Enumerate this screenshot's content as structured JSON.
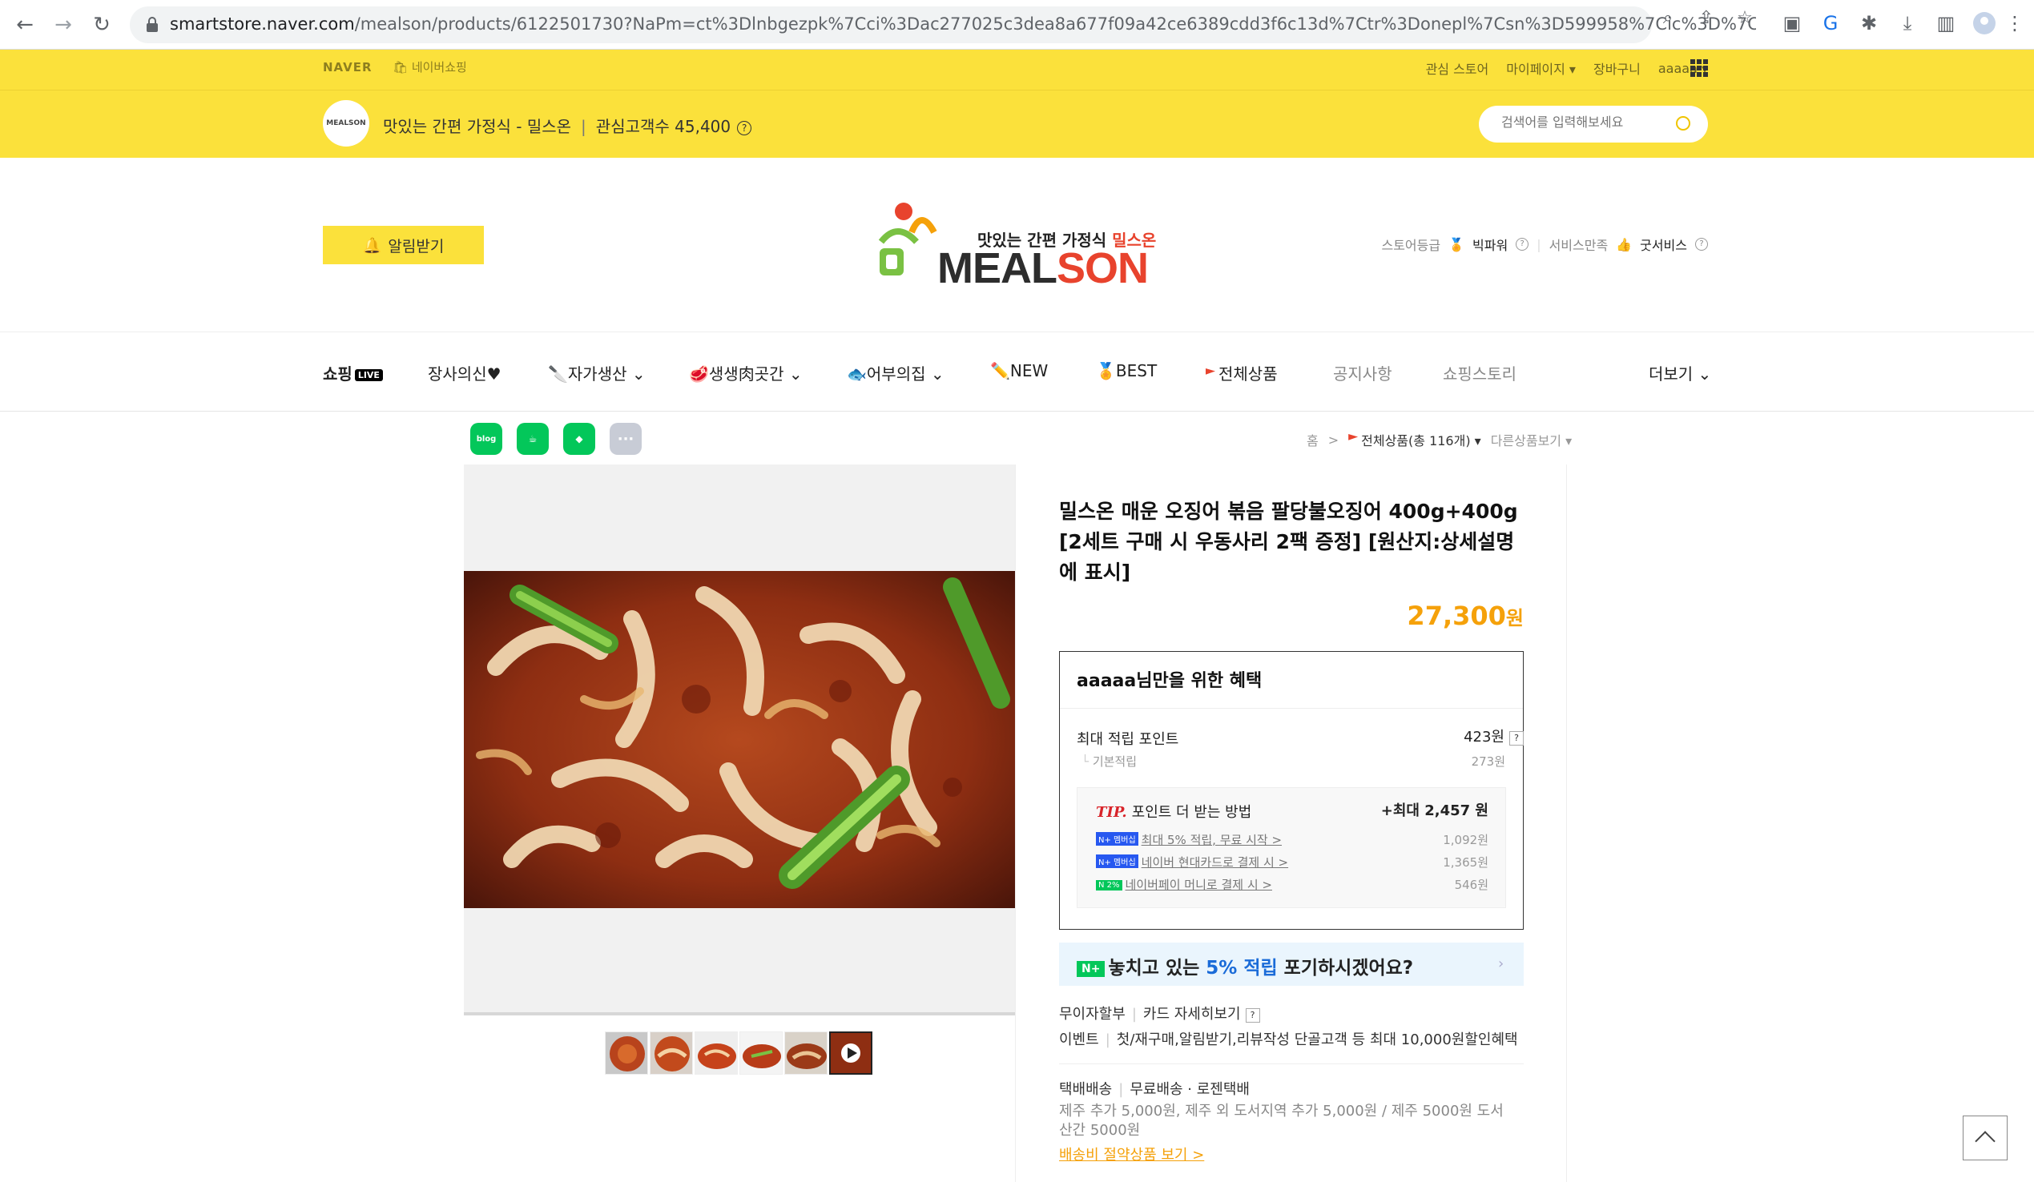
{
  "browser": {
    "url_host": "smartstore.naver.com",
    "url_path": "/mealson/products/6122501730?NaPm=ct%3Dlnbgezpk%7Cci%3Dac277025c3dea8a677f09a42ce6389cdd3f6c13d%7Ctr%3Donepl%7Csn%3D599958%7Cic%3D%7Chk%3..."
  },
  "naver_top": {
    "logo": "NAVER",
    "shopping": "네이버쇼핑",
    "links": [
      "관심 스토어",
      "마이페이지 ▾",
      "장바구니",
      "aaaaa ▾"
    ]
  },
  "store": {
    "avatar_text": "MEALSON",
    "title": "맛있는 간편 가정식 - 밀스온",
    "follower_label": "관심고객수 45,400",
    "search_placeholder": "검색어를 입력해보세요"
  },
  "header": {
    "alarm_label": "알림받기",
    "logo_tag_black": "맛있는 간편 가정식 ",
    "logo_tag_red": "밀스온",
    "logo_main_a": "MEAL",
    "logo_main_b": "SON",
    "grade_label": "스토어등급",
    "grade_value": "빅파워",
    "service_label": "서비스만족",
    "service_value": "굿서비스"
  },
  "categories": [
    {
      "label": "쇼핑",
      "badge": "LIVE"
    },
    {
      "label": "장사의신♥"
    },
    {
      "label": "자가생산 ⌄"
    },
    {
      "label": "생생肉곳간 ⌄"
    },
    {
      "label": "어부의집 ⌄"
    },
    {
      "label": "NEW"
    },
    {
      "label": "BEST"
    },
    {
      "label": "전체상품"
    },
    {
      "label": "공지사항"
    },
    {
      "label": "쇼핑스토리"
    },
    {
      "label": "더보기 ⌄"
    }
  ],
  "share": [
    "blog",
    "",
    "",
    "···"
  ],
  "breadcrumb": {
    "home": "홈",
    "sep": ">",
    "current": "전체상품(총 116개) ▾",
    "other": "다른상품보기 ▾"
  },
  "product": {
    "title": "밀스온 매운 오징어 볶음 팔당불오징어 400g+400g [2세트 구매 시 우동사리 2팩 증정] [원산지:상세설명에 표시]",
    "price": "27,300",
    "price_unit": "원"
  },
  "benefit": {
    "header": "aaaaa님만을 위한 혜택",
    "max_point_label": "최대 적립 포인트",
    "max_point_value": "423원",
    "basic_label": "기본적립",
    "basic_value": "273원",
    "tip_label": "TIP.",
    "tip_title": "포인트 더 받는 방법",
    "tip_max": "+최대 2,457 원",
    "tip_rows": [
      {
        "badge": "N+ 멤버십",
        "text": "최대 5% 적립, 무료 시작 >",
        "value": "1,092원"
      },
      {
        "badge": "N+ 멤버십",
        "text": "네이버 현대카드로 결제 시 >",
        "value": "1,365원"
      },
      {
        "badge": "N 2%",
        "text": "네이버페이 머니로 결제 시 >",
        "value": "546원"
      }
    ]
  },
  "banner": {
    "badge": "N+",
    "pre": "놓치고 있는 ",
    "highlight": "5% 적립",
    "post": " 포기하시겠어요?"
  },
  "extras": {
    "installment": "무이자할부",
    "card_detail": "카드 자세히보기",
    "event_label": "이벤트",
    "event_text": "첫/재구매,알림받기,리뷰작성 단골고객 등 최대 10,000원할인혜택",
    "delivery_label": "택배배송",
    "delivery_text": "무료배송 · 로젠택배",
    "delivery_note": "제주 추가 5,000원, 제주 외 도서지역 추가 5,000원 / 제주 5000원 도서 산간 5000원",
    "ship_link": "배송비 절약상품 보기 >"
  }
}
